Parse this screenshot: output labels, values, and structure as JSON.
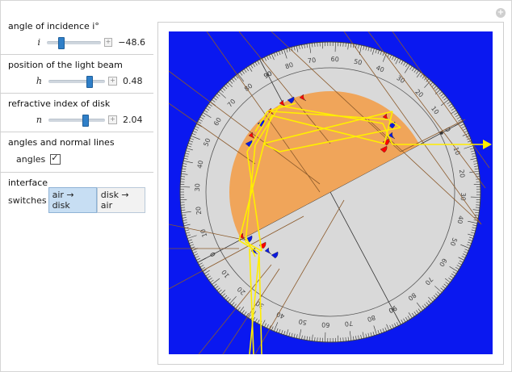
{
  "corner_button": "+",
  "controls": {
    "incidence": {
      "title": "angle of incidence i°",
      "var": "i",
      "value": "−48.6",
      "fraction": 0.22
    },
    "position": {
      "title": "position of the light beam",
      "var": "h",
      "value": "0.48",
      "fraction": 0.74
    },
    "index": {
      "title": "refractive index of disk",
      "var": "n",
      "value": "2.04",
      "fraction": 0.66
    },
    "angles": {
      "title": "angles and normal lines",
      "checkbox_label": "angles",
      "checked": true
    },
    "interface": {
      "title": "interface",
      "row_label": "switches",
      "buttons": [
        "air → disk",
        "disk → air"
      ],
      "active": 0
    }
  },
  "protractor": {
    "ticks_deg": [
      "0",
      "10",
      "20",
      "30",
      "40",
      "50",
      "60",
      "70",
      "80",
      "90"
    ]
  },
  "colors": {
    "background": "#0a18f0",
    "protractor": "#d9d9d9",
    "disk": "#f0a55a",
    "ray": "#ffee00",
    "wedge_red": "#ff0000",
    "wedge_blue": "#0b1ae0"
  }
}
